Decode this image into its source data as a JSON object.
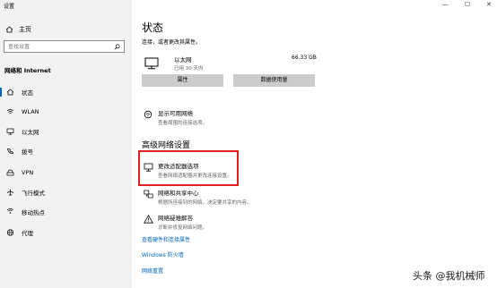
{
  "window": {
    "title": "设置",
    "minimize": "—",
    "maximize": "☐",
    "close": "✕"
  },
  "sidebar": {
    "home_label": "主页",
    "search_placeholder": "查找设置",
    "section_title": "网络和 Internet",
    "items": [
      {
        "label": "状态",
        "icon": "home-network-icon",
        "active": true
      },
      {
        "label": "WLAN",
        "icon": "wifi-icon",
        "active": false
      },
      {
        "label": "以太网",
        "icon": "ethernet-icon",
        "active": false
      },
      {
        "label": "拨号",
        "icon": "phone-icon",
        "active": false
      },
      {
        "label": "VPN",
        "icon": "vpn-icon",
        "active": false
      },
      {
        "label": "飞行模式",
        "icon": "airplane-icon",
        "active": false
      },
      {
        "label": "移动热点",
        "icon": "hotspot-icon",
        "active": false
      },
      {
        "label": "代理",
        "icon": "globe-icon",
        "active": false
      }
    ]
  },
  "main": {
    "title": "状态",
    "subtitle": "连接，或者更改其属性。",
    "network": {
      "name": "以太网",
      "status": "已用 30 天内",
      "data_used": "66.33 GB"
    },
    "buttons": {
      "properties": "属性",
      "data_usage": "数据使用量"
    },
    "show_networks": {
      "title": "显示可用网络",
      "desc": "查看周围的连接选项。"
    },
    "advanced_title": "高级网络设置",
    "adapter": {
      "title": "更改适配器选项",
      "desc": "查看网络适配器并更改连接设置。"
    },
    "sharing": {
      "title": "网络和共享中心",
      "desc": "根据所连接到的网络，决定要共享的内容。"
    },
    "troubleshoot": {
      "title": "网络疑难解答",
      "desc": "诊断并修复网络问题。"
    },
    "links": {
      "hardware": "查看硬件和连接属性",
      "firewall": "Windows 防火墙",
      "reset": "网络重置"
    }
  },
  "watermark": "头条 @我机械师",
  "colors": {
    "accent": "#0067c0",
    "highlight": "#e02020",
    "sidebar_bg": "#f2f2f2",
    "button_bg": "#cccccc"
  }
}
